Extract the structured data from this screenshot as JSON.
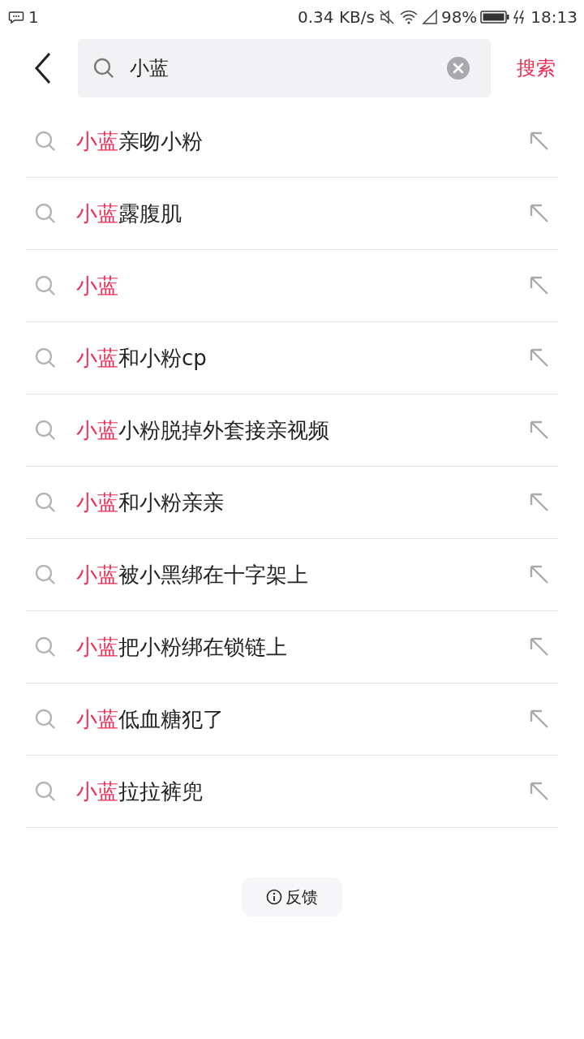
{
  "status_bar": {
    "notification_count": "1",
    "speed": "0.34 KB/s",
    "battery": "98%",
    "time": "18:13"
  },
  "search": {
    "value": "小蓝",
    "submit": "搜索"
  },
  "suggestions": [
    {
      "match": "小蓝",
      "rest": "亲吻小粉"
    },
    {
      "match": "小蓝",
      "rest": "露腹肌"
    },
    {
      "match": "小蓝"
    },
    {
      "match": "小蓝",
      "rest": "和小粉cp"
    },
    {
      "match": "小蓝",
      "rest": "小粉脱掉外套接亲视频"
    },
    {
      "match": "小蓝",
      "rest": "和小粉亲亲"
    },
    {
      "match": "小蓝",
      "rest": "被小黑绑在十字架上"
    },
    {
      "match": "小蓝",
      "rest": "把小粉绑在锁链上"
    },
    {
      "match": "小蓝",
      "rest": "低血糖犯了"
    },
    {
      "match": "小蓝",
      "rest": "拉拉裤兜"
    }
  ],
  "feedback": "反馈"
}
